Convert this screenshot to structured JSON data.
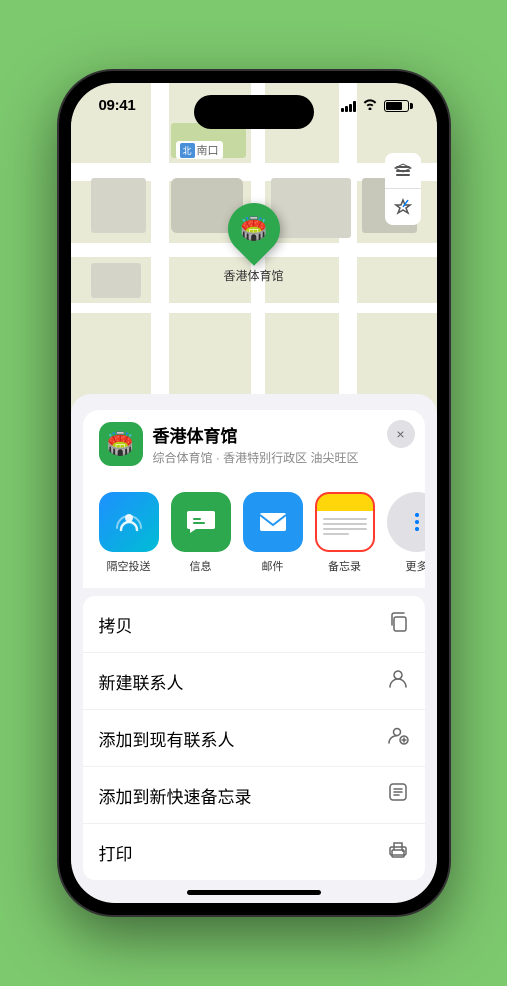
{
  "statusBar": {
    "time": "09:41",
    "timeIcon": "location-arrow-icon"
  },
  "map": {
    "northLabel": "南口",
    "northTag": "北",
    "stadiumName": "香港体育馆",
    "stadiumEmoji": "🏟️"
  },
  "mapControls": {
    "layersLabel": "🗺",
    "locationLabel": "↗"
  },
  "venueCard": {
    "title": "香港体育馆",
    "subtitle": "综合体育馆 · 香港特别行政区 油尖旺区",
    "icon": "🏟️",
    "closeLabel": "×"
  },
  "shareItems": [
    {
      "id": "airdrop",
      "label": "隔空投送",
      "type": "airdrop"
    },
    {
      "id": "messages",
      "label": "信息",
      "type": "messages"
    },
    {
      "id": "mail",
      "label": "邮件",
      "type": "mail"
    },
    {
      "id": "notes",
      "label": "备忘录",
      "type": "notes",
      "highlighted": true
    }
  ],
  "moreLabel": "更多",
  "actions": [
    {
      "id": "copy",
      "label": "拷贝",
      "icon": "📋"
    },
    {
      "id": "new-contact",
      "label": "新建联系人",
      "icon": "👤"
    },
    {
      "id": "add-to-contact",
      "label": "添加到现有联系人",
      "icon": "👤+"
    },
    {
      "id": "add-to-notes",
      "label": "添加到新快速备忘录",
      "icon": "📝"
    },
    {
      "id": "print",
      "label": "打印",
      "icon": "🖨"
    }
  ]
}
